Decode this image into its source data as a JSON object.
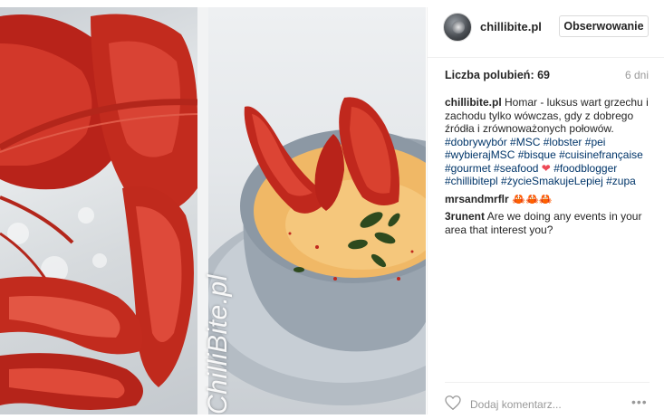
{
  "post": {
    "watermark": "ChilliBite.pl",
    "username": "chillibite.pl",
    "follow_label": "Obserwowanie",
    "likes_label": "Liczba polubień:",
    "likes_count": "69",
    "age": "6 dni",
    "caption": {
      "author": "chillibite.pl",
      "text": "Homar - luksus wart grzechu i zachodu tylko wówczas, gdy z dobrego źródła i zrównoważonych połowów.",
      "hashtags_line1": [
        "#dobrywybór",
        "#MSC",
        "#lobster",
        "#pei"
      ],
      "hashtags_line2": [
        "#wybierajMSC",
        "#bisque",
        "#cuisinefrançaise"
      ],
      "hashtags_line3a": [
        "#gourmet",
        "#seafood"
      ],
      "heart_emoji": "❤",
      "hashtags_line3b": [
        "#foodblogger"
      ],
      "hashtags_line4": [
        "#chillibitepl",
        "#życieSmakujeLepiej",
        "#zupa"
      ]
    },
    "comments": [
      {
        "author": "mrsandmrflr",
        "text": "🦀🦀🦀"
      },
      {
        "author": "3runent",
        "text": "Are we doing any events in your area that interest you?"
      }
    ],
    "comment_placeholder": "Dodaj komentarz...",
    "more_label": "•••"
  },
  "colors": {
    "hashtag": "#003569",
    "lobster_red": "#c0281d",
    "soup": "#f2b45c"
  },
  "icons": {
    "like": "heart-outline-icon",
    "more": "ellipsis-icon"
  }
}
